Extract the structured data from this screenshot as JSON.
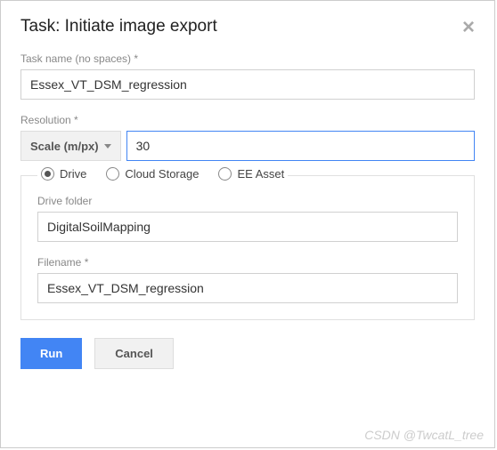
{
  "dialog": {
    "title": "Task: Initiate image export"
  },
  "taskName": {
    "label": "Task name (no spaces) *",
    "value": "Essex_VT_DSM_regression"
  },
  "resolution": {
    "label": "Resolution *",
    "scaleLabel": "Scale (m/px)",
    "value": "30"
  },
  "destination": {
    "options": {
      "drive": "Drive",
      "cloud": "Cloud Storage",
      "ee": "EE Asset"
    },
    "selected": "drive",
    "driveFolder": {
      "label": "Drive folder",
      "value": "DigitalSoilMapping"
    },
    "filename": {
      "label": "Filename *",
      "value": "Essex_VT_DSM_regression"
    }
  },
  "buttons": {
    "run": "Run",
    "cancel": "Cancel"
  },
  "watermark": "CSDN @TwcatL_tree"
}
